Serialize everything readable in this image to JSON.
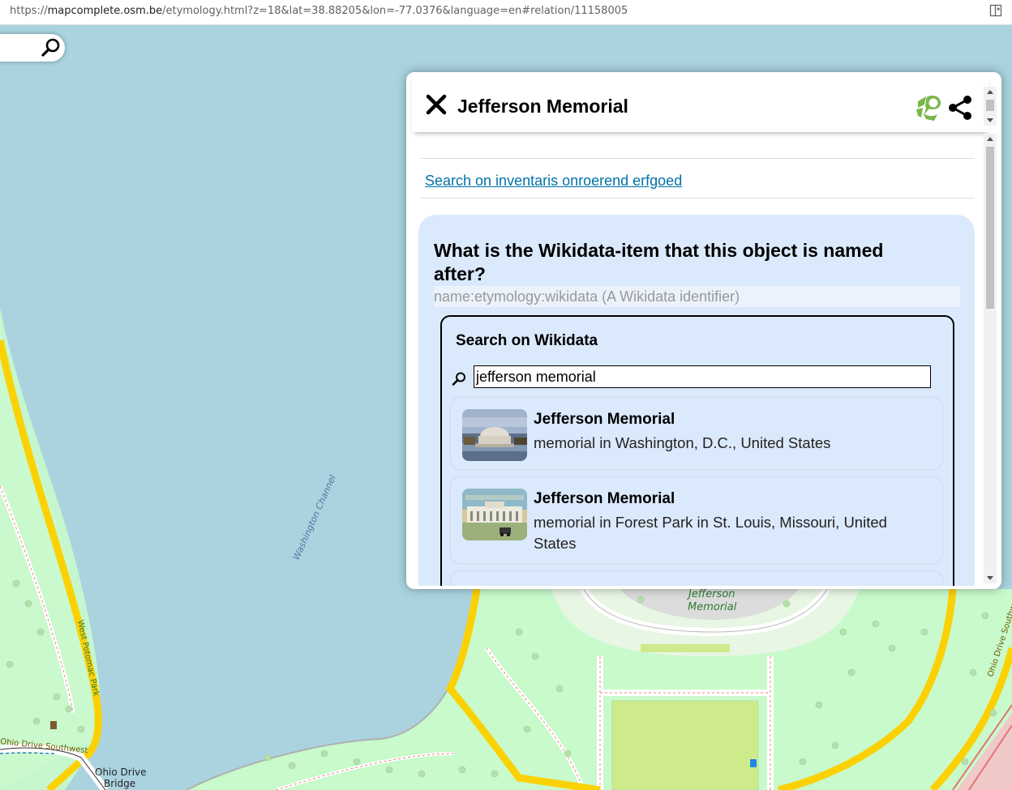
{
  "browser": {
    "url_scheme": "https://",
    "url_host": "mapcomplete.osm.be",
    "url_rest": "/etymology.html?z=18&lat=38.88205&lon=-77.0376&language=en#relation/11158005"
  },
  "map": {
    "labels": {
      "washington_channel": "Washington Channel",
      "west_potomac_park": "West Potomac Park",
      "ohio_drive_southwest": "Ohio Drive Southwest",
      "ohio_drive_bridge_1": "Ohio Drive",
      "ohio_drive_bridge_2": "Bridge",
      "jefferson_memorial_1": "Jefferson",
      "jefferson_memorial_2": "Memorial",
      "ohio_drive_right": "Ohio Drive Southw"
    },
    "colors": {
      "water": "#aad3df",
      "park": "#c8facc",
      "road_major": "#fcd104"
    }
  },
  "popup": {
    "title": "Jefferson Memorial",
    "ioe_link": "Search on inventaris onroerend erfgoed",
    "question": {
      "title": "What is the Wikidata-item that this object is named after?",
      "key_hint": "name:etymology:wikidata (A Wikidata identifier)",
      "search": {
        "title": "Search on Wikidata",
        "value": "jefferson memorial"
      },
      "results": [
        {
          "title": "Jefferson Memorial",
          "description": "memorial in Washington, D.C., United States"
        },
        {
          "title": "Jefferson Memorial",
          "description": "memorial in Forest Park in St. Louis, Missouri, United States"
        }
      ]
    }
  }
}
